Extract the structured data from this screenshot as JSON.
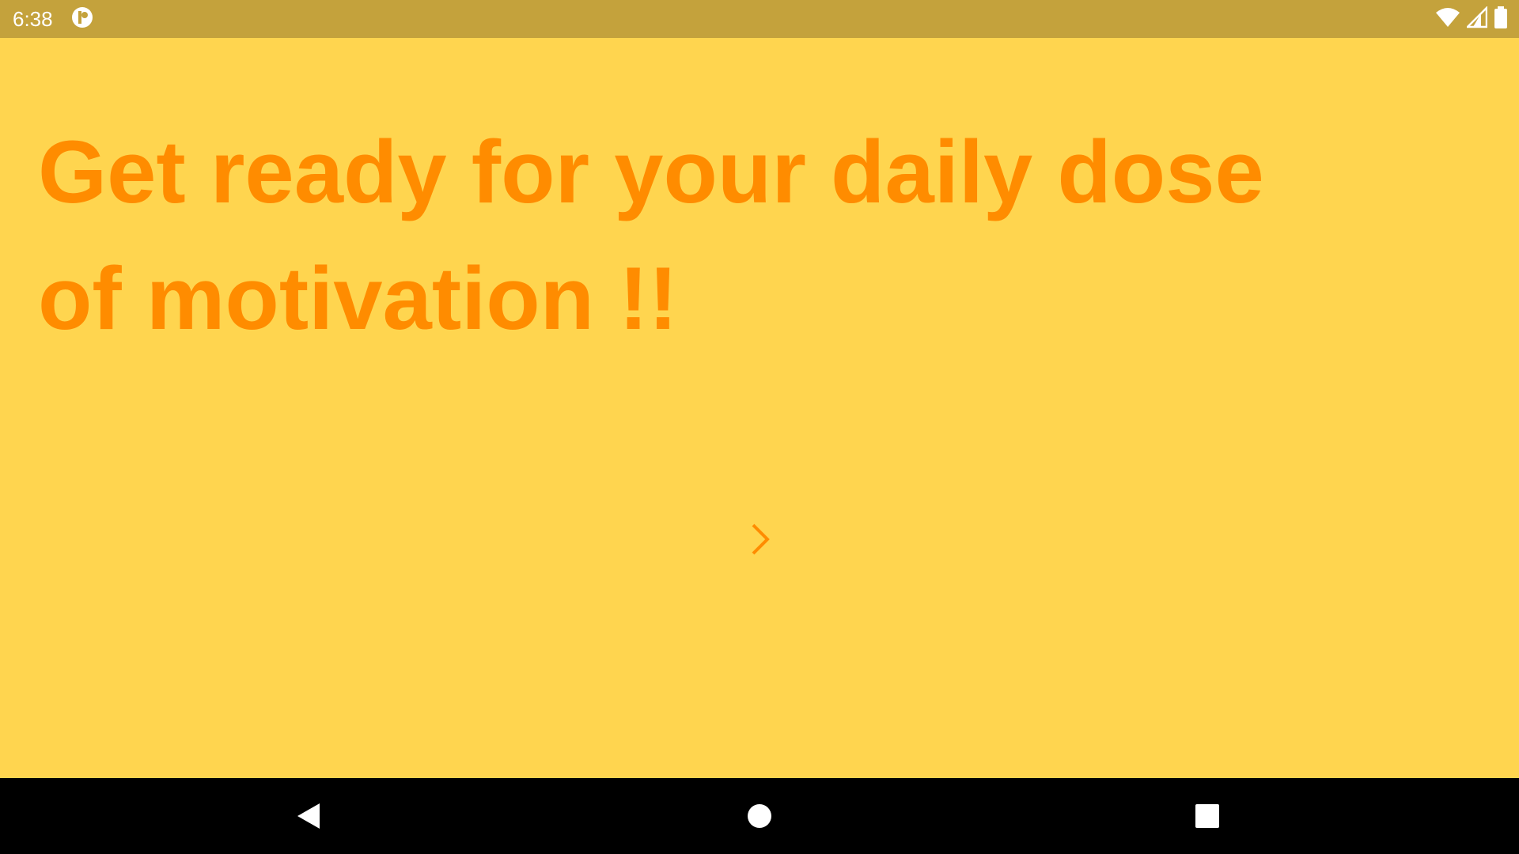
{
  "status_bar": {
    "time": "6:38",
    "icons": [
      "app-notification-icon",
      "wifi-icon",
      "cellular-signal-icon",
      "battery-icon"
    ]
  },
  "main": {
    "headline": "Get ready for your daily dose of motivation !!",
    "next_icon": "chevron-right-icon"
  },
  "nav_bar": {
    "icons": [
      "back-icon",
      "home-icon",
      "recents-icon"
    ]
  },
  "colors": {
    "background": "#FFD54F",
    "status_bar": "#C4A23C",
    "accent_text": "#FF8C00",
    "nav_bar": "#000000"
  }
}
